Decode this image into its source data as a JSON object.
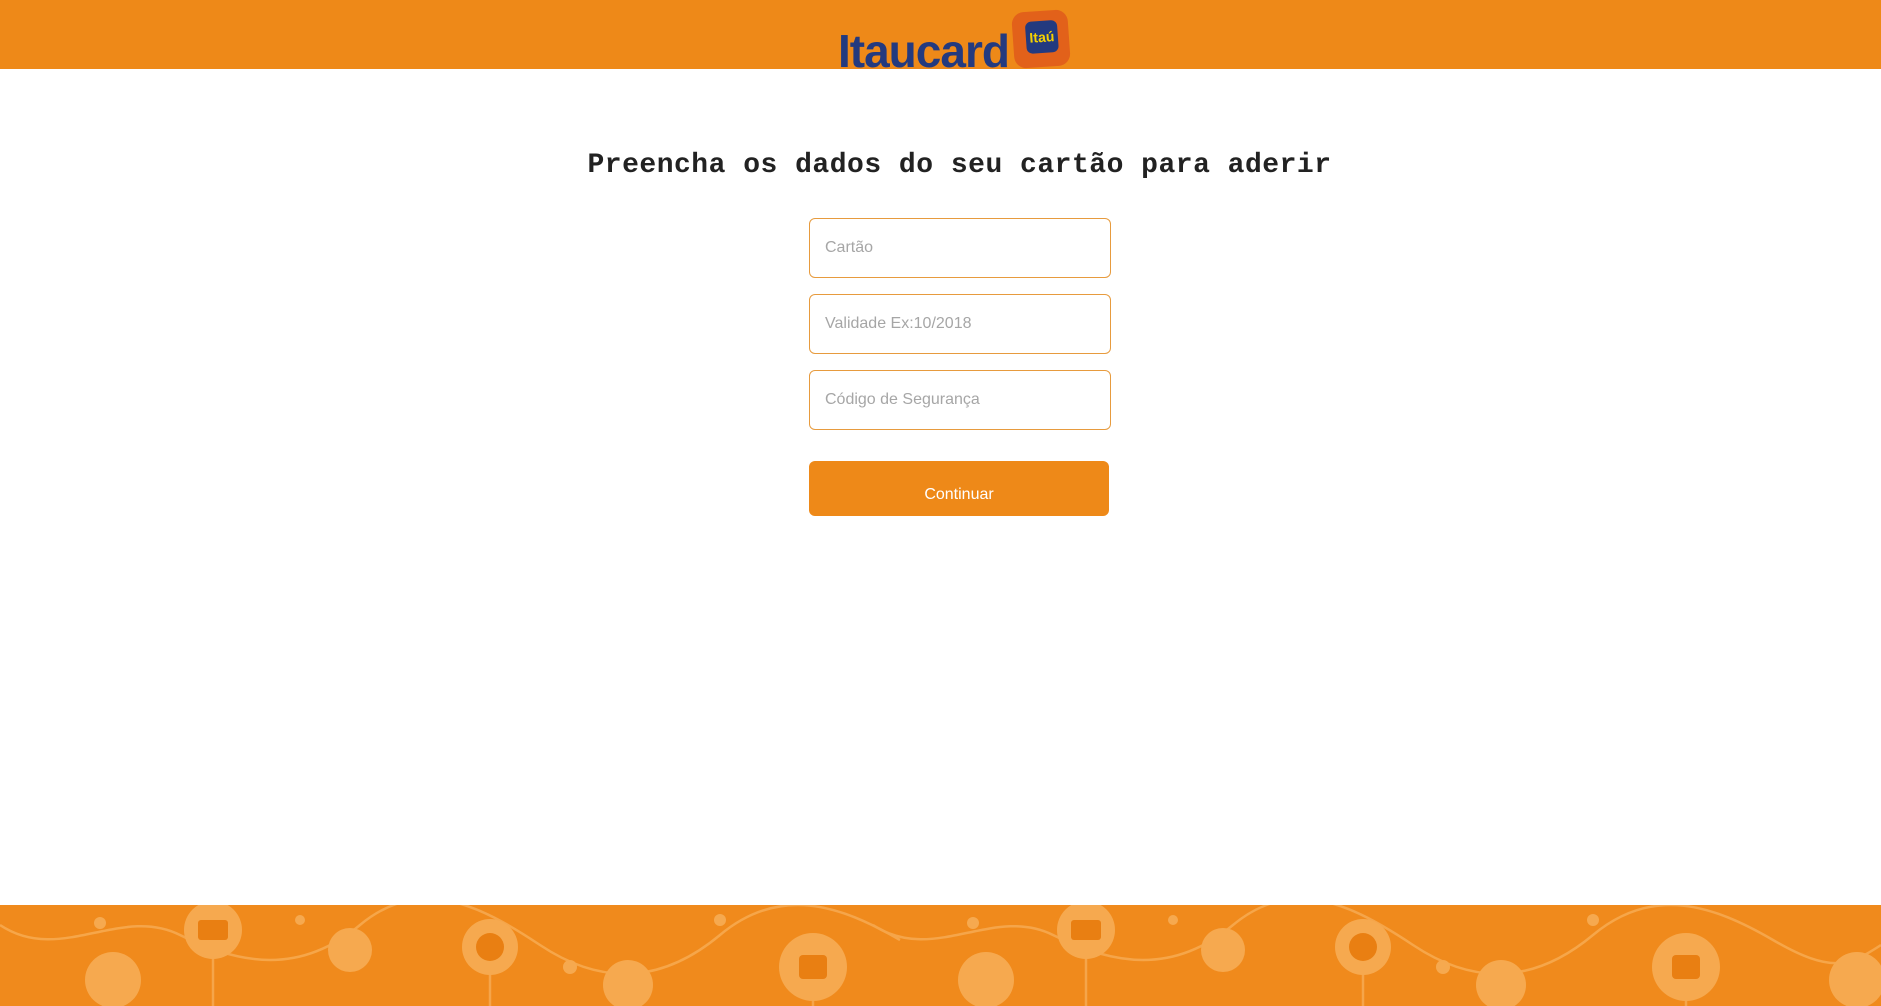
{
  "header": {
    "logo_text": "Itaucard",
    "logo_badge_text": "Itaú",
    "background_color": "#ee8918",
    "logo_color": "#233a7f"
  },
  "main": {
    "title": "Preencha os dados do seu cartão para aderir",
    "fields": [
      {
        "name": "card-number",
        "placeholder": "Cartão",
        "value": ""
      },
      {
        "name": "expiry",
        "placeholder": "Validade Ex:10/2018",
        "value": ""
      },
      {
        "name": "security-code",
        "placeholder": "Código de Segurança",
        "value": ""
      }
    ],
    "submit_label": "Continuar",
    "accent_color": "#ee8918",
    "field_border_color": "#e79b3e"
  },
  "footer": {
    "pattern_icons": [
      "globe-icon",
      "monitor-icon",
      "thumbs-up-icon",
      "smiley-icon",
      "user-icon",
      "itau-logo-icon",
      "location-pin-icon",
      "star-icon",
      "chat-bubble-icon"
    ]
  }
}
